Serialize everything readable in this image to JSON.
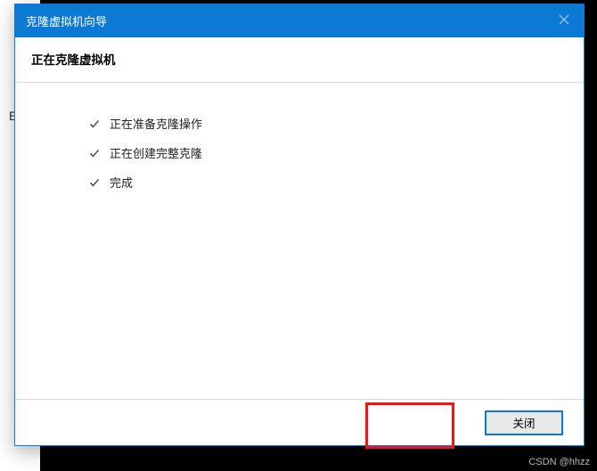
{
  "backdrop": {
    "left_char": "E"
  },
  "titlebar": {
    "title": "克隆虚拟机向导",
    "close_icon_name": "close-icon"
  },
  "header": {
    "title": "正在克隆虚拟机"
  },
  "steps": [
    {
      "label": "正在准备克隆操作",
      "status": "done"
    },
    {
      "label": "正在创建完整克隆",
      "status": "done"
    },
    {
      "label": "完成",
      "status": "done"
    }
  ],
  "footer": {
    "close_label": "关闭"
  },
  "highlight": {
    "description": "red-annotation-box-around-close-button",
    "color": "#f11414"
  },
  "watermark": "CSDN @hhzz"
}
